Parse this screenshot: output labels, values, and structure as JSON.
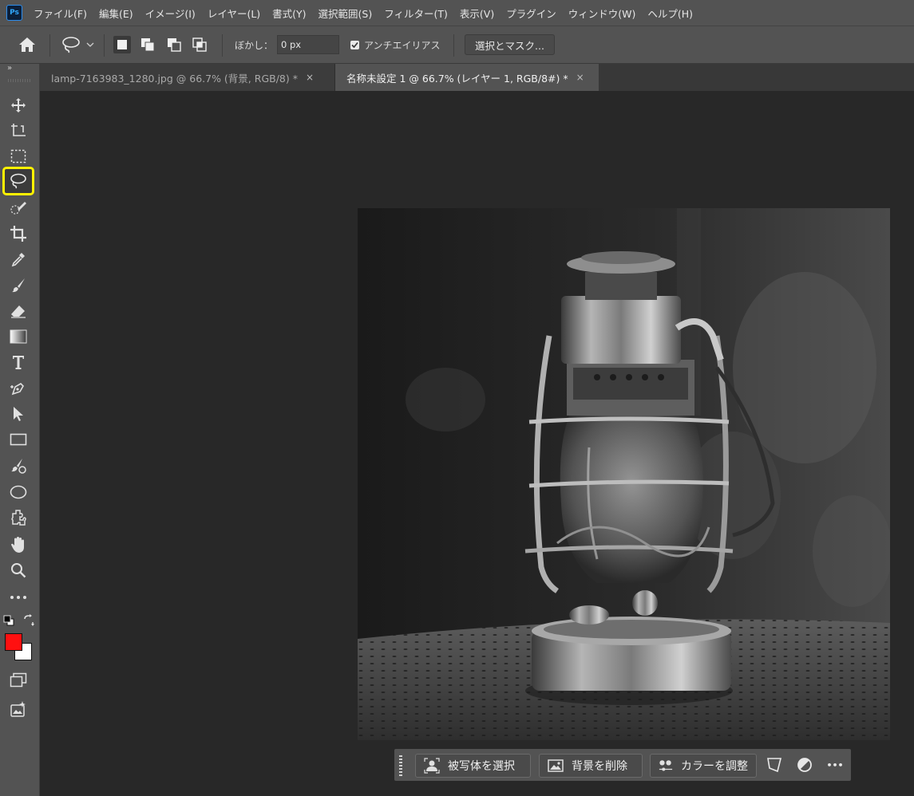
{
  "app": {
    "logo_text": "Ps"
  },
  "menu": {
    "items": [
      "ファイル(F)",
      "編集(E)",
      "イメージ(I)",
      "レイヤー(L)",
      "書式(Y)",
      "選択範囲(S)",
      "フィルター(T)",
      "表示(V)",
      "プラグイン",
      "ウィンドウ(W)",
      "ヘルプ(H)"
    ]
  },
  "options": {
    "feather_label": "ぼかし：",
    "feather_value": "0 px",
    "antialias_label": "アンチエイリアス",
    "antialias_checked": true,
    "select_mask_label": "選択とマスク..."
  },
  "toolbar": {
    "collapse_glyph": "»",
    "active_tool": "lasso",
    "foreground_color": "#ff1010",
    "background_color": "#ffffff",
    "highlight_color": "#fff200"
  },
  "tabs": [
    {
      "label": "lamp-7163983_1280.jpg @ 66.7% (背景, RGB/8) *",
      "active": false
    },
    {
      "label": "名称未設定 1 @ 66.7% (レイヤー 1, RGB/8#) *",
      "active": true
    }
  ],
  "tab_close_glyph": "×",
  "contextual_bar": {
    "select_subject_label": "被写体を選択",
    "remove_background_label": "背景を削除",
    "adjust_color_label": "カラーを調整",
    "more_glyph": "•••"
  }
}
